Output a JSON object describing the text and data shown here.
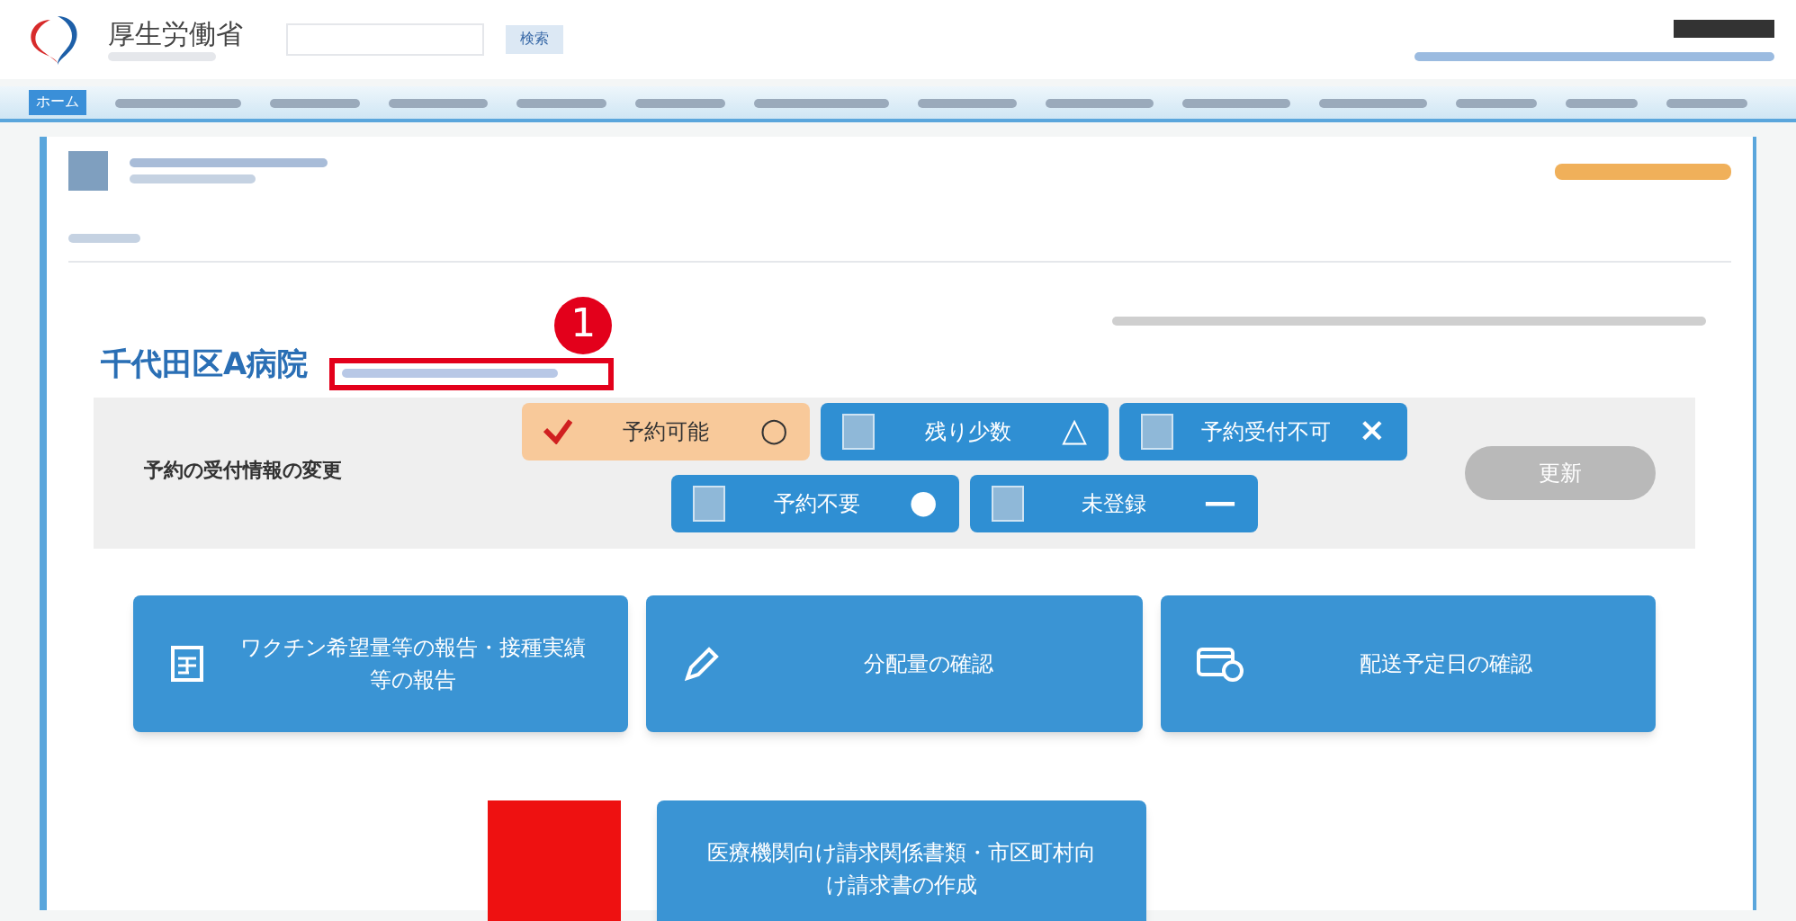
{
  "header": {
    "logo_text": "厚生労働省",
    "search_button": "検索"
  },
  "nav": {
    "items": [
      {
        "label": "ホーム",
        "selected": true
      }
    ]
  },
  "hospital": {
    "name": "千代田区A病院"
  },
  "annotation": {
    "number": "1"
  },
  "reservation": {
    "label": "予約の受付情報の変更",
    "update_button": "更新",
    "statuses": [
      {
        "label": "予約可能",
        "symbol": "○",
        "selected": true
      },
      {
        "label": "残り少数",
        "symbol": "△",
        "selected": false
      },
      {
        "label": "予約受付不可",
        "symbol": "×",
        "selected": false
      },
      {
        "label": "予約不要",
        "symbol": "●",
        "selected": false
      },
      {
        "label": "未登録",
        "symbol": "—",
        "selected": false
      }
    ]
  },
  "menu": [
    {
      "kind": "report",
      "label": "ワクチン希望量等の報告・接種実績等の報告"
    },
    {
      "kind": "pencil",
      "label": "分配量の確認"
    },
    {
      "kind": "calendar",
      "label": "配送予定日の確認"
    },
    {
      "kind": "none",
      "label": "医療機関向け請求関係書類・市区町村向け請求書の作成"
    }
  ]
}
